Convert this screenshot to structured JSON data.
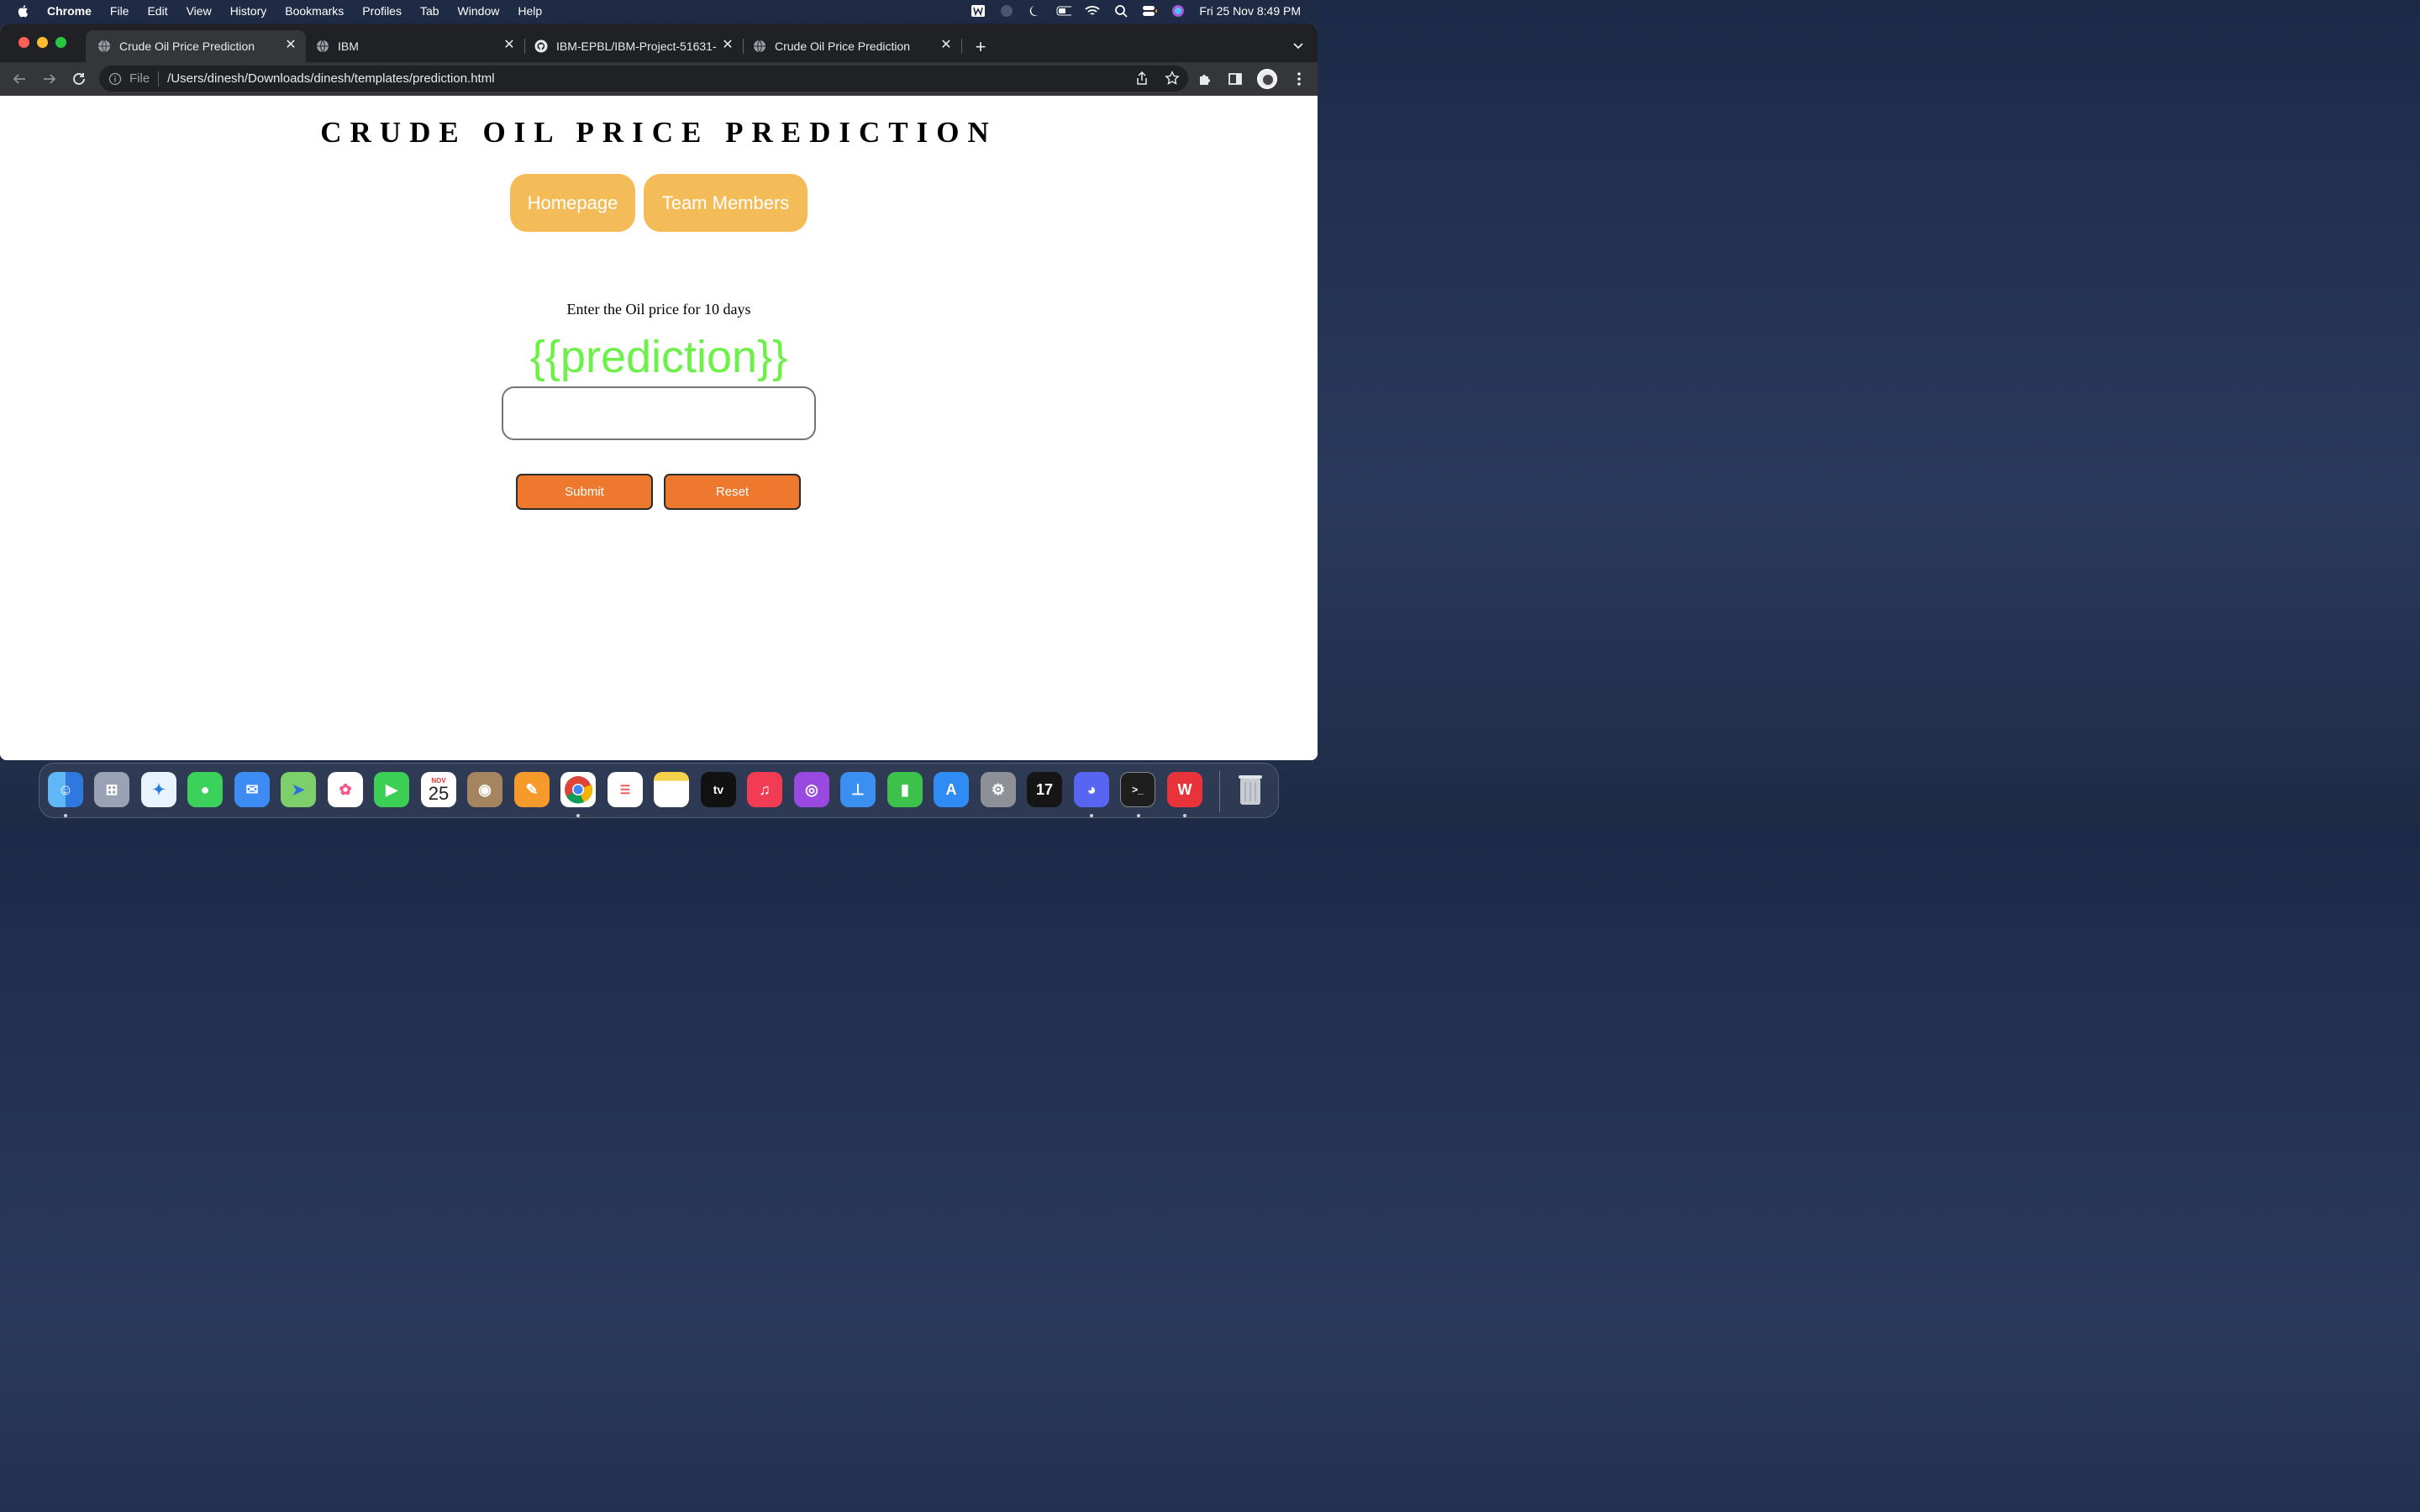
{
  "menubar": {
    "app_name": "Chrome",
    "items": [
      "File",
      "Edit",
      "View",
      "History",
      "Bookmarks",
      "Profiles",
      "Tab",
      "Window",
      "Help"
    ],
    "datetime": "Fri 25 Nov  8:49 PM"
  },
  "tabs": [
    {
      "title": "Crude Oil Price Prediction",
      "active": true
    },
    {
      "title": "IBM",
      "active": false
    },
    {
      "title": "IBM-EPBL/IBM-Project-51631-",
      "active": false
    },
    {
      "title": "Crude Oil Price Prediction",
      "active": false
    }
  ],
  "address_bar": {
    "scheme_label": "File",
    "url": "/Users/dinesh/Downloads/dinesh/templates/prediction.html"
  },
  "page": {
    "title": "CRUDE OIL PRICE PREDICTION",
    "nav": {
      "homepage": "Homepage",
      "team_members": "Team Members"
    },
    "prompt": "Enter the Oil price for 10 days",
    "prediction": "{{prediction}}",
    "input_value": "",
    "submit_label": "Submit",
    "reset_label": "Reset"
  },
  "calendar_icon": {
    "month": "NOV",
    "day": "25"
  },
  "colors": {
    "nav_button": "#f3bc58",
    "action_button": "#ee782e",
    "prediction_text": "#6ef04a"
  },
  "dock_icons": [
    "finder-icon",
    "launchpad-icon",
    "safari-icon",
    "messages-icon",
    "mail-icon",
    "maps-icon",
    "photos-icon",
    "facetime-icon",
    "calendar-icon",
    "contacts-icon",
    "pages-icon",
    "chrome-icon",
    "reminders-icon",
    "notes-icon",
    "apple-tv-icon",
    "music-icon",
    "podcasts-icon",
    "keynote-icon",
    "numbers-icon",
    "app-store-icon",
    "system-preferences-icon",
    "tradingview-icon",
    "discord-icon",
    "terminal-icon",
    "wps-office-icon",
    "trash-icon"
  ]
}
